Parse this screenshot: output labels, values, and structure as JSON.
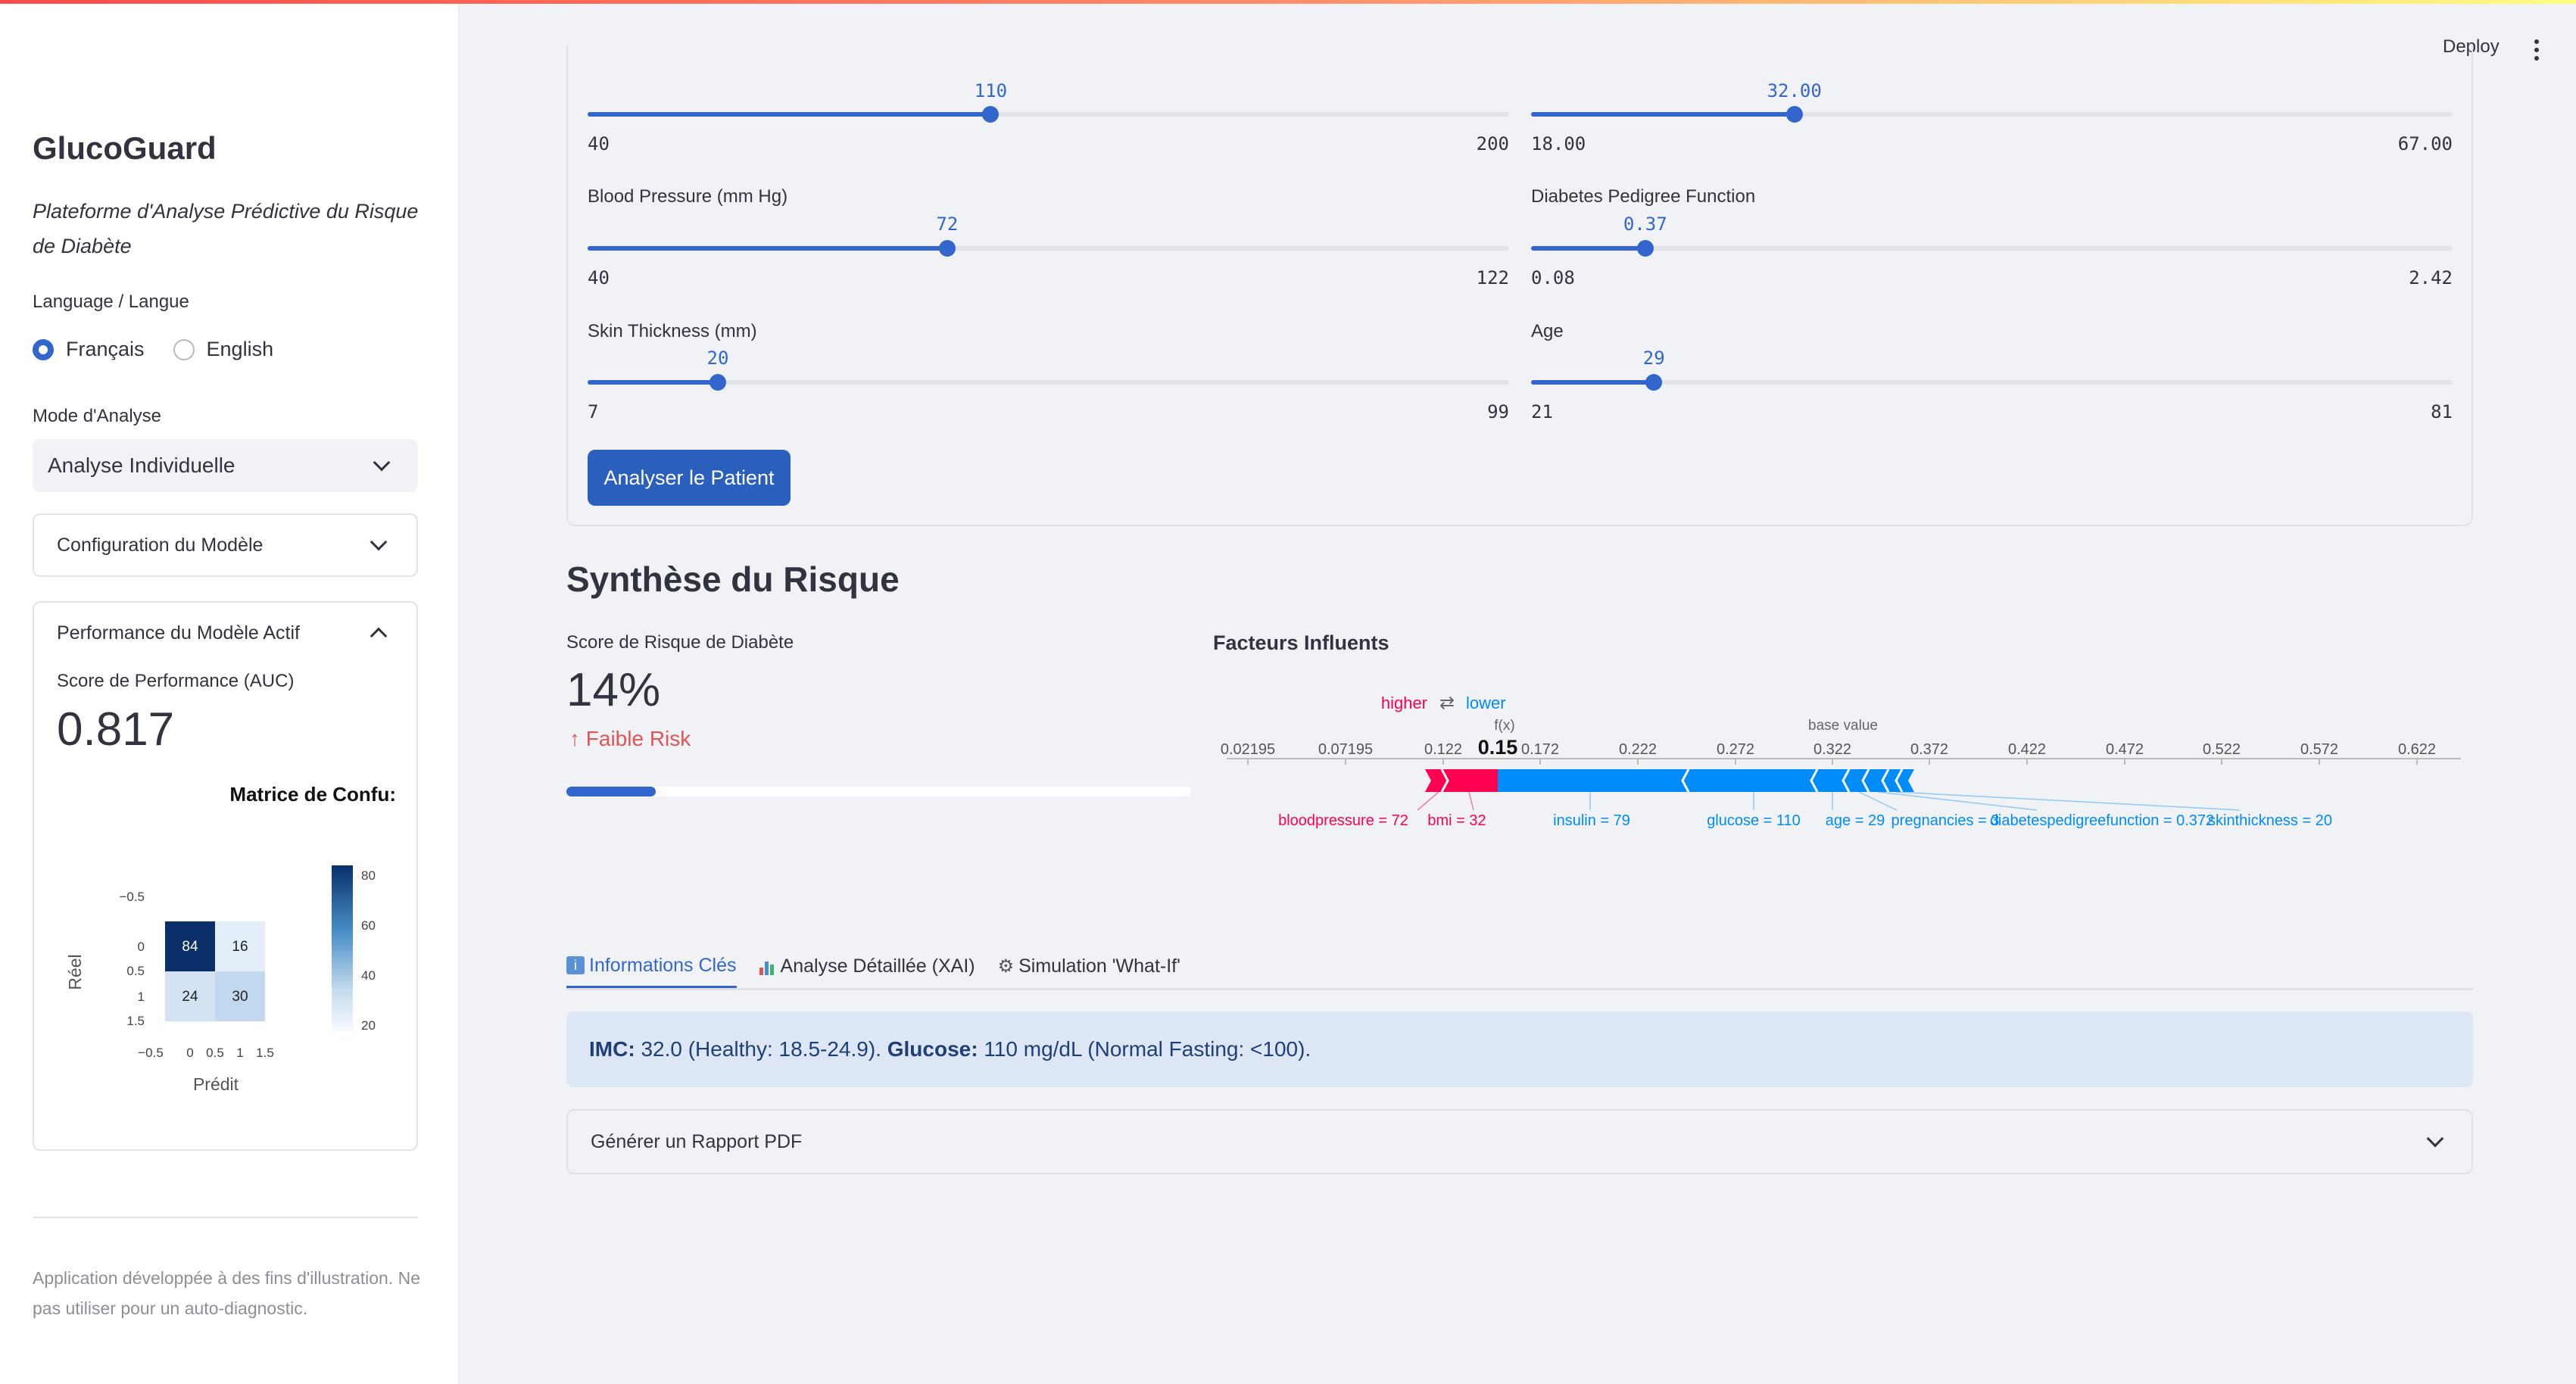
{
  "header": {
    "deploy_label": "Deploy"
  },
  "sidebar": {
    "title": "GlucoGuard",
    "subtitle": "Plateforme d'Analyse Prédictive du Risque de Diabète",
    "language_label": "Language / Langue",
    "language_options": [
      "Français",
      "English"
    ],
    "language_selected": "Français",
    "mode_label": "Mode d'Analyse",
    "mode_value": "Analyse Individuelle",
    "model_config_label": "Configuration du Modèle",
    "performance": {
      "header": "Performance du Modèle Actif",
      "auc_label": "Score de Performance (AUC)",
      "auc_value": "0.817",
      "cm_title": "Matrice de Confu:",
      "cm_ylabel": "Réel",
      "cm_xlabel": "Prédit",
      "cm_values": [
        [
          84,
          16
        ],
        [
          24,
          30
        ]
      ],
      "cm_yticks": [
        "−0.5",
        "0",
        "0.5",
        "1",
        "1.5"
      ],
      "cm_xticks": [
        "−0.5",
        "0",
        "0.5",
        "1",
        "1.5"
      ],
      "cbar_ticks": [
        "80",
        "60",
        "40",
        "20"
      ]
    },
    "footer": "Application développée à des fins d'illustration. Ne pas utiliser pour un auto-diagnostic."
  },
  "form": {
    "sliders": [
      {
        "label": "",
        "value": "110",
        "min": "40",
        "max": "200",
        "fraction": 0.4375
      },
      {
        "label": "",
        "value": "32.00",
        "min": "18.00",
        "max": "67.00",
        "fraction": 0.2857
      },
      {
        "label": "Blood Pressure (mm Hg)",
        "value": "72",
        "min": "40",
        "max": "122",
        "fraction": 0.3902
      },
      {
        "label": "Diabetes Pedigree Function",
        "value": "0.37",
        "min": "0.08",
        "max": "2.42",
        "fraction": 0.1239
      },
      {
        "label": "Skin Thickness (mm)",
        "value": "20",
        "min": "7",
        "max": "99",
        "fraction": 0.1413
      },
      {
        "label": "Age",
        "value": "29",
        "min": "21",
        "max": "81",
        "fraction": 0.1333
      }
    ],
    "analyze_button": "Analyser le Patient"
  },
  "risk": {
    "title": "Synthèse du Risque",
    "score_label": "Score de Risque de Diabète",
    "score_value": "14%",
    "delta_text": "Faible Risk",
    "progress": 0.14,
    "factors_title": "Facteurs Influents"
  },
  "force_plot": {
    "higher": "higher",
    "lower": "lower",
    "fx_label": "f(x)",
    "fx_value": "0.15",
    "base_label": "base value",
    "ticks": [
      "0.02195",
      "0.07195",
      "0.122",
      "0.172",
      "0.222",
      "0.272",
      "0.322",
      "0.372",
      "0.422",
      "0.472",
      "0.522",
      "0.572",
      "0.622"
    ],
    "pos_features": [
      "bloodpressure = 72",
      "bmi = 32"
    ],
    "neg_features": [
      "insulin = 79",
      "glucose = 110",
      "age = 29",
      "pregnancies = 3",
      "diabetespedigreefunction = 0.372",
      "skinthickness = 20"
    ],
    "colors": {
      "pos": "#ff0051",
      "neg": "#008bfb"
    }
  },
  "tabs": [
    "Informations Clés",
    "Analyse Détaillée (XAI)",
    "Simulation 'What-If'"
  ],
  "info": {
    "imc_label": "IMC:",
    "imc_text": "32.0 (Healthy: 18.5-24.9).",
    "glucose_label": "Glucose:",
    "glucose_text": "110 mg/dL (Normal Fasting: <100)."
  },
  "pdf_expander": "Générer un Rapport PDF"
}
